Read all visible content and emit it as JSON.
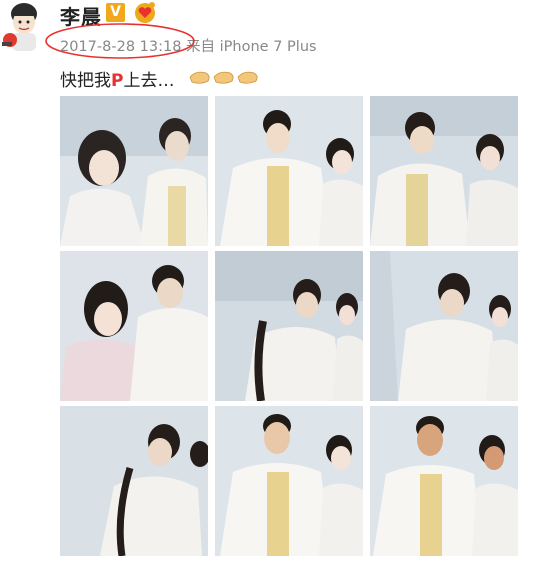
{
  "post": {
    "author": "李晨",
    "verified_badge": "V",
    "timestamp": "2017-8-28 13:18",
    "source": "来自 iPhone 7 Plus",
    "text_before": "快把我",
    "text_highlight": "P",
    "text_after": "上去…",
    "icons": [
      "avatar",
      "verified-v-icon",
      "heart-badge-icon",
      "clapping-hands-icon"
    ]
  },
  "colors": {
    "accent_red": "#e8322f",
    "meta_gray": "#888888",
    "verified_orange": "#f2a81d"
  },
  "images": [
    {
      "label": "photo-1"
    },
    {
      "label": "photo-2"
    },
    {
      "label": "photo-3"
    },
    {
      "label": "photo-4"
    },
    {
      "label": "photo-5"
    },
    {
      "label": "photo-6"
    },
    {
      "label": "photo-7"
    },
    {
      "label": "photo-8"
    },
    {
      "label": "photo-9"
    }
  ]
}
